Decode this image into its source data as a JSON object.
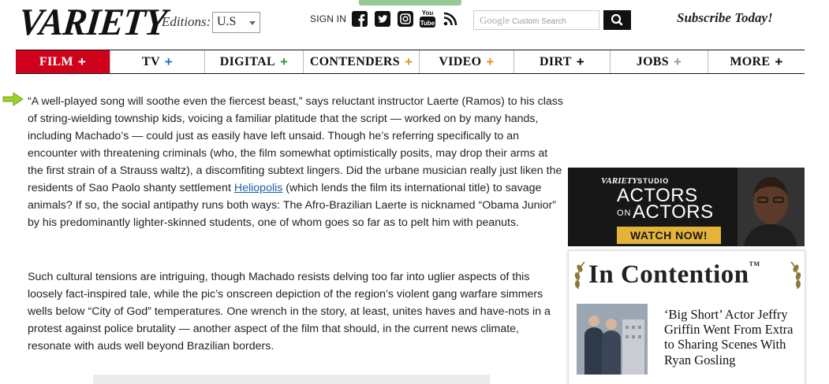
{
  "header": {
    "logo": "VARIETY",
    "editions_label": "Editions:",
    "edition_selected": "U.S",
    "signin": "SIGN IN",
    "search_brand": "Google",
    "search_placeholder": "Custom Search",
    "subscribe": "Subscribe Today!"
  },
  "nav": {
    "items": [
      {
        "label": "FILM",
        "plus": "+",
        "plus_color": "#ffffff",
        "active": true
      },
      {
        "label": "TV",
        "plus": "+",
        "plus_color": "#1e6fc2"
      },
      {
        "label": "DIGITAL",
        "plus": "+",
        "plus_color": "#2f9a3a"
      },
      {
        "label": "CONTENDERS",
        "plus": "+",
        "plus_color": "#d99a1a"
      },
      {
        "label": "VIDEO",
        "plus": "+",
        "plus_color": "#f08a1c"
      },
      {
        "label": "DIRT",
        "plus": "+",
        "plus_color": "#111111"
      },
      {
        "label": "JOBS",
        "plus": "+",
        "plus_color": "#999999"
      },
      {
        "label": "MORE",
        "plus": "+",
        "plus_color": "#111111"
      }
    ]
  },
  "article": {
    "para1_before_link": "“A well-played song will soothe even the fiercest beast,” says reluctant instructor Laerte (Ramos) to his class of string-wielding township kids, voicing a familiar platitude that the script — worked on by many hands, including Machado’s — could just as easily have left unsaid. Though he’s referring specifically to an encounter with threatening criminals (who, the film somewhat optimistically posits, may drop their arms at the first strain of a Strauss waltz), a discomfiting subtext lingers. Did the urbane musician really just liken the residents of Sao Paolo shanty settlement ",
    "para1_link": "Heliopolis",
    "para1_after_link": " (which lends the film its international title) to savage animals? If so, the social antipathy runs both ways: The Afro-Brazilian Laerte is nicknamed “Obama Junior” by his predominantly lighter-skinned students, one of whom goes so far as to pelt him with peanuts.",
    "para2": "Such cultural tensions are intriguing, though Machado resists delving too far into uglier aspects of this loosely fact-inspired tale, while the pic’s onscreen depiction of the region’s violent gang warfare simmers wells below “City of God” temperatures. One wrench in the story, at least, unites haves and have-nots in a protest against police brutality — another aspect of the film that should, in the current news climate, resonate with auds well beyond Brazilian borders."
  },
  "ad": {
    "brand": "VARIETY",
    "brand_suffix": "STUDIO",
    "line1": "ACTORS",
    "line_on": "ON",
    "line2": "ACTORS",
    "cta": "WATCH NOW!"
  },
  "sidebar": {
    "section_title": "In Contention",
    "tm": "TM",
    "story_title": "‘Big Short’ Actor Jeffry Griffin Went From Extra to Sharing Scenes With Ryan Gosling"
  }
}
